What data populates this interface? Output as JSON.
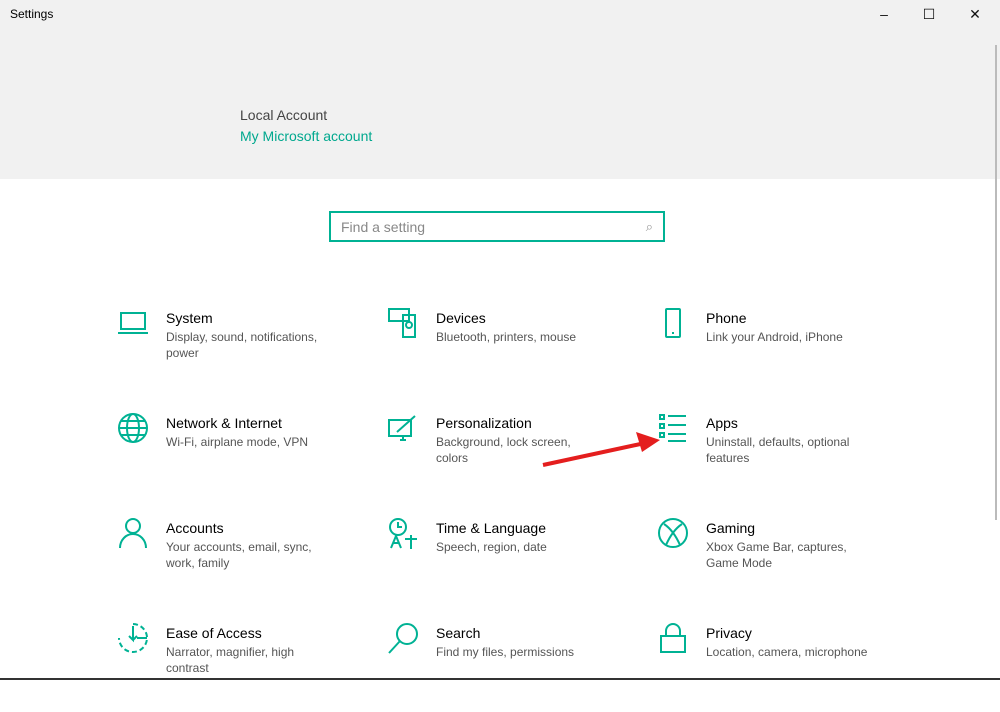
{
  "window": {
    "title": "Settings",
    "minimize": "–",
    "maximize": "☐",
    "close": "✕"
  },
  "account": {
    "type": "Local Account",
    "link": "My Microsoft account"
  },
  "search": {
    "placeholder": "Find a setting",
    "icon": "search-icon"
  },
  "accent": "#00b294",
  "tiles": [
    {
      "title": "System",
      "desc": "Display, sound, notifications, power",
      "icon": "laptop-icon"
    },
    {
      "title": "Devices",
      "desc": "Bluetooth, printers, mouse",
      "icon": "devices-icon"
    },
    {
      "title": "Phone",
      "desc": "Link your Android, iPhone",
      "icon": "phone-icon"
    },
    {
      "title": "Network & Internet",
      "desc": "Wi-Fi, airplane mode, VPN",
      "icon": "globe-icon"
    },
    {
      "title": "Personalization",
      "desc": "Background, lock screen, colors",
      "icon": "paintbrush-icon"
    },
    {
      "title": "Apps",
      "desc": "Uninstall, defaults, optional features",
      "icon": "apps-list-icon"
    },
    {
      "title": "Accounts",
      "desc": "Your accounts, email, sync, work, family",
      "icon": "person-icon"
    },
    {
      "title": "Time & Language",
      "desc": "Speech, region, date",
      "icon": "time-language-icon"
    },
    {
      "title": "Gaming",
      "desc": "Xbox Game Bar, captures, Game Mode",
      "icon": "xbox-icon"
    },
    {
      "title": "Ease of Access",
      "desc": "Narrator, magnifier, high contrast",
      "icon": "ease-of-access-icon"
    },
    {
      "title": "Search",
      "desc": "Find my files, permissions",
      "icon": "magnifier-icon"
    },
    {
      "title": "Privacy",
      "desc": "Location, camera, microphone",
      "icon": "lock-icon"
    }
  ]
}
